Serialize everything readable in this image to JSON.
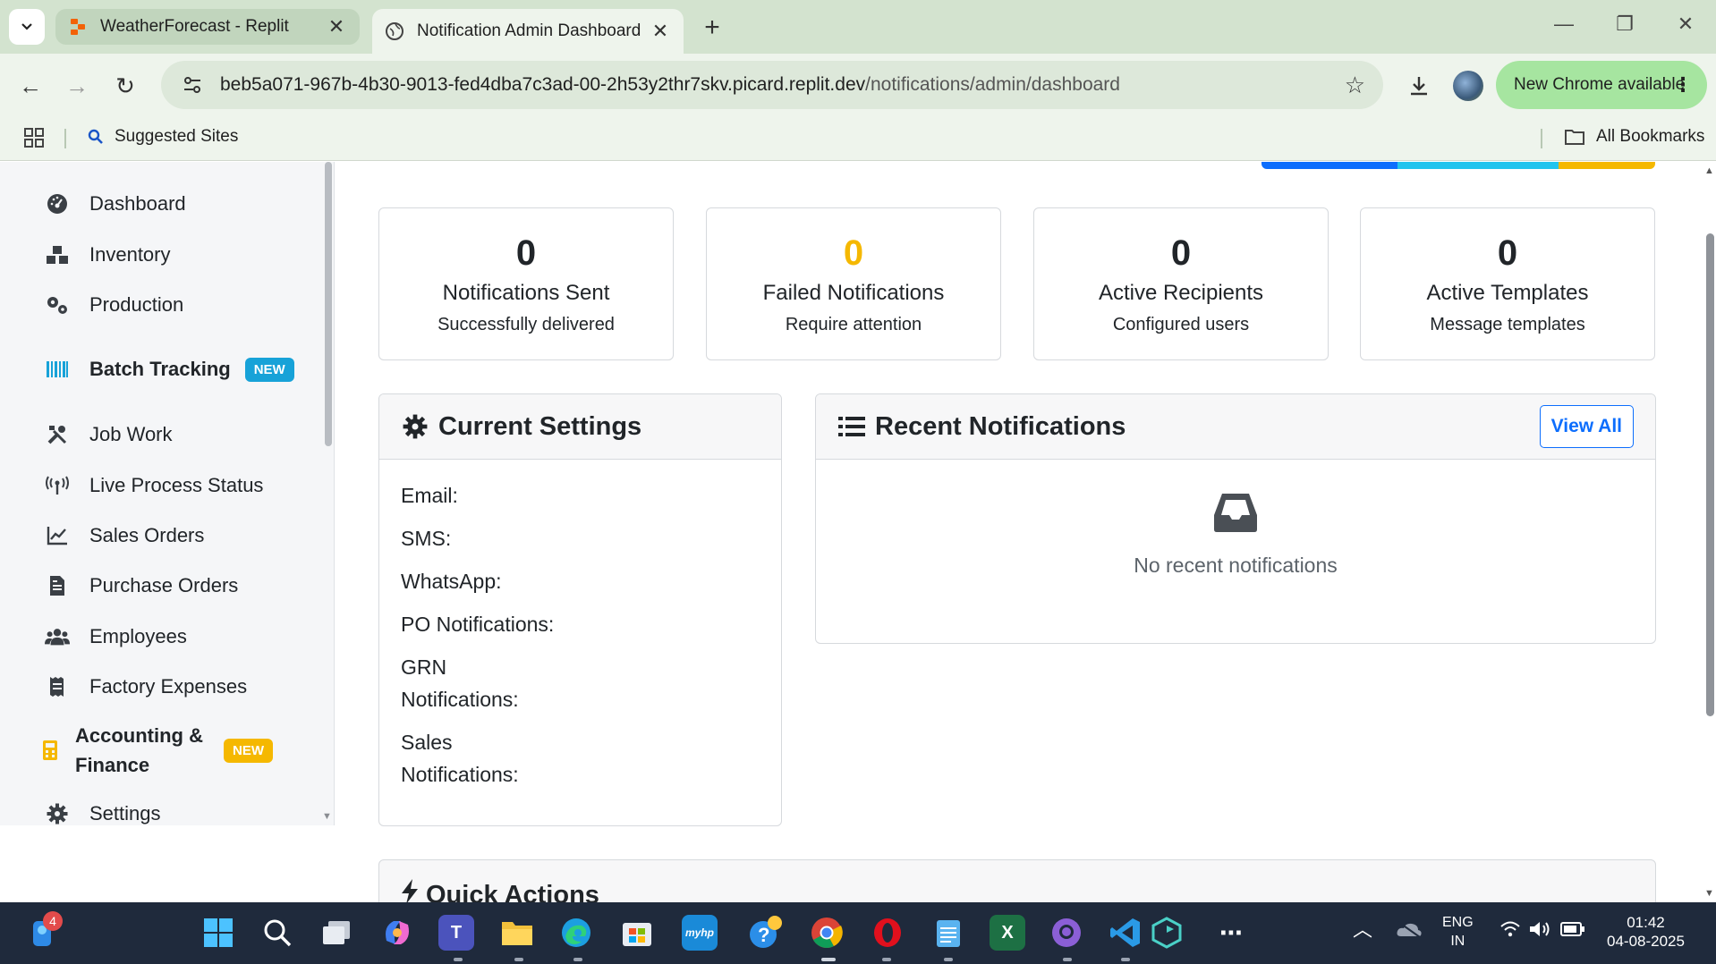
{
  "browser": {
    "tabs": [
      {
        "title": "WeatherForecast - Replit",
        "active": false
      },
      {
        "title": "Notification Admin Dashboard",
        "active": true
      }
    ],
    "url_host": "beb5a071-967b-4b30-9013-fed4dba7c3ad-00-2h53y2thr7skv.picard.replit.dev",
    "url_path": "/notifications/admin/dashboard",
    "update_label": "New Chrome available",
    "bookmarks": {
      "suggested": "Suggested Sites",
      "all": "All Bookmarks"
    }
  },
  "sidebar": {
    "items": [
      {
        "label": "Dashboard",
        "icon": "dashboard-gauge-icon"
      },
      {
        "label": "Inventory",
        "icon": "boxes-icon"
      },
      {
        "label": "Production",
        "icon": "cogs-icon"
      },
      {
        "label": "Batch Tracking",
        "icon": "barcode-icon",
        "badge": "NEW",
        "badge_color": "#17a2d8"
      },
      {
        "label": "Job Work",
        "icon": "tools-icon"
      },
      {
        "label": "Live Process Status",
        "icon": "broadcast-icon"
      },
      {
        "label": "Sales Orders",
        "icon": "line-chart-icon"
      },
      {
        "label": "Purchase Orders",
        "icon": "file-invoice-icon"
      },
      {
        "label": "Employees",
        "icon": "users-icon"
      },
      {
        "label": "Factory Expenses",
        "icon": "receipt-icon"
      },
      {
        "label": "Accounting & Finance",
        "icon": "calculator-icon",
        "badge": "NEW",
        "badge_color": "#f5b800"
      },
      {
        "label": "Settings",
        "icon": "gear-icon"
      }
    ]
  },
  "stats": [
    {
      "value": "0",
      "label": "Notifications Sent",
      "sub": "Successfully delivered",
      "color": "#212529"
    },
    {
      "value": "0",
      "label": "Failed Notifications",
      "sub": "Require attention",
      "color": "#f5b800"
    },
    {
      "value": "0",
      "label": "Active Recipients",
      "sub": "Configured users",
      "color": "#212529"
    },
    {
      "value": "0",
      "label": "Active Templates",
      "sub": "Message templates",
      "color": "#212529"
    }
  ],
  "current_settings": {
    "title": "Current Settings",
    "rows": [
      "Email:",
      "SMS:",
      "WhatsApp:",
      "PO Notifications:",
      "GRN Notifications:",
      "Sales Notifications:"
    ]
  },
  "recent_notifications": {
    "title": "Recent Notifications",
    "view_all": "View All",
    "empty_message": "No recent notifications"
  },
  "quick_actions": {
    "title": "Quick Actions"
  },
  "taskbar": {
    "notification_count": "4",
    "language": "ENG",
    "region": "IN",
    "time": "01:42",
    "date": "04-08-2025"
  },
  "colors": {
    "primary": "#0d6efd",
    "warning": "#f5b800",
    "info": "#17a2d8"
  }
}
